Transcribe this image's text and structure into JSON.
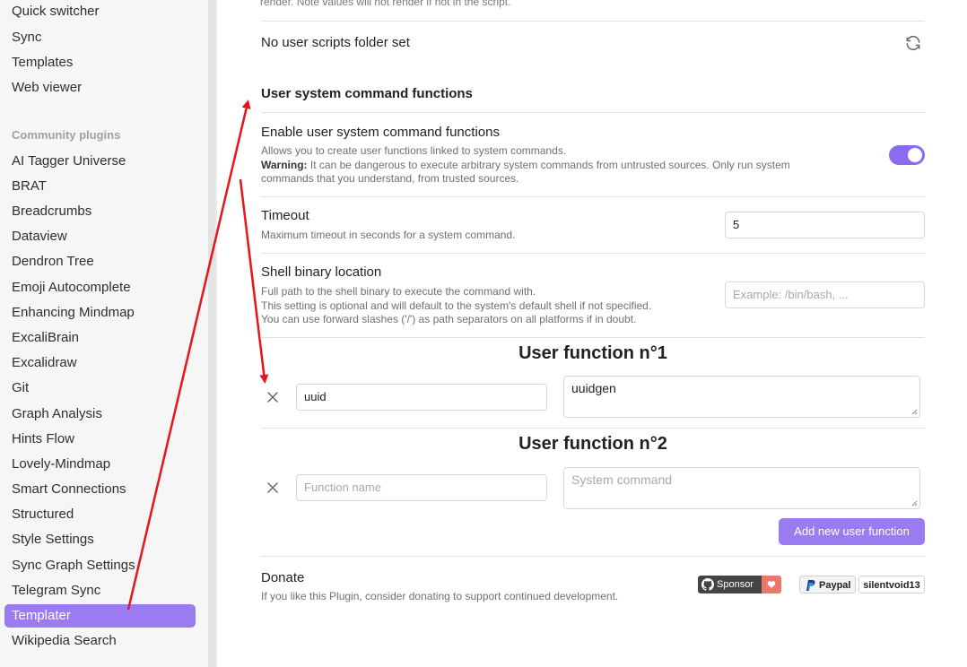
{
  "sidebar": {
    "core_items": [
      "Quick switcher",
      "Sync",
      "Templates",
      "Web viewer"
    ],
    "section_label": "Community plugins",
    "community_items": [
      "AI Tagger Universe",
      "BRAT",
      "Breadcrumbs",
      "Dataview",
      "Dendron Tree",
      "Emoji Autocomplete",
      "Enhancing Mindmap",
      "ExcaliBrain",
      "Excalidraw",
      "Git",
      "Graph Analysis",
      "Hints Flow",
      "Lovely-Mindmap",
      "Smart Connections",
      "Structured",
      "Style Settings",
      "Sync Graph Settings",
      "Telegram Sync",
      "Templater",
      "Wikipedia Search"
    ],
    "active_item": "Templater"
  },
  "main": {
    "cut_text": "render. Note values will not render if not in the script.",
    "user_scripts_label": "No user scripts folder set",
    "section_heading": "User system command functions",
    "enable": {
      "name": "Enable user system command functions",
      "desc1": "Allows you to create user functions linked to system commands.",
      "warning_label": "Warning:",
      "warning_text": " It can be dangerous to execute arbitrary system commands from untrusted sources. Only run system commands that you understand, from trusted sources.",
      "enabled": true
    },
    "timeout": {
      "name": "Timeout",
      "desc": "Maximum timeout in seconds for a system command.",
      "value": "5"
    },
    "shell": {
      "name": "Shell binary location",
      "desc1": "Full path to the shell binary to execute the command with.",
      "desc2": "This setting is optional and will default to the system's default shell if not specified.",
      "desc3": "You can use forward slashes ('/') as path separators on all platforms if in doubt.",
      "placeholder": "Example: /bin/bash, ..."
    },
    "user_functions": [
      {
        "title": "User function n°1",
        "name_value": "uuid",
        "command_value": "uuidgen"
      },
      {
        "title": "User function n°2",
        "name_placeholder": "Function name",
        "command_placeholder": "System command"
      }
    ],
    "add_button_label": "Add new user function",
    "donate": {
      "name": "Donate",
      "desc": "If you like this Plugin, consider donating to support continued development.",
      "sponsor_label": "Sponsor",
      "paypal_label": "Paypal",
      "paypal_user": "silentvoid13"
    }
  },
  "colors": {
    "accent": "#9a7cf0",
    "annotation_arrow": "#e8141c"
  }
}
